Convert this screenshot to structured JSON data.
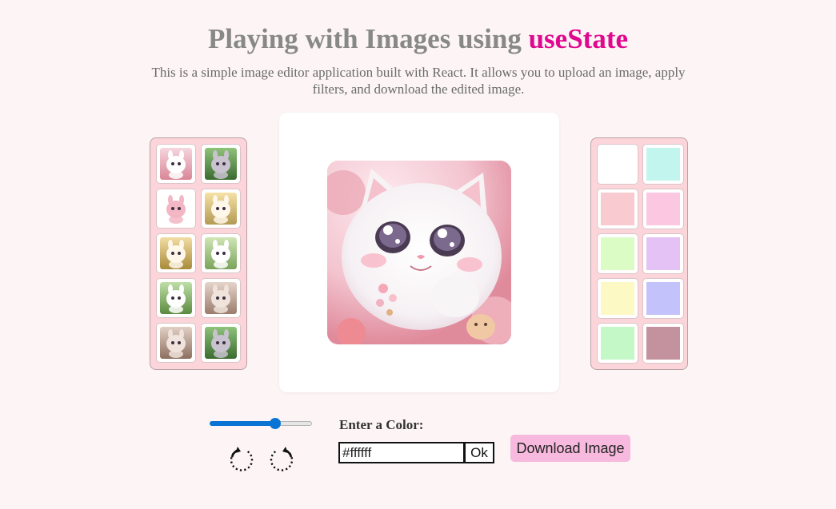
{
  "header": {
    "title_prefix": "Playing with Images using ",
    "title_accent": "useState",
    "subtitle": "This is a simple image editor application built with React. It allows you to upload an image, apply filters, and download the edited image."
  },
  "colors": {
    "accent": "#e0088e",
    "background": "#fdf5f5",
    "panel": "#fcd5da",
    "slider": "#0a74d4",
    "download": "#f7b9dd"
  },
  "thumbnails": [
    {
      "icon": "white-kitten-image",
      "bg": [
        "#f6d6df",
        "#d98697"
      ],
      "fg": "#ffffff"
    },
    {
      "icon": "forest-mouse-image",
      "bg": [
        "#8fc27a",
        "#3b6b2f"
      ],
      "fg": "#c9c3cf"
    },
    {
      "icon": "pink-sheep-image",
      "bg": [
        "#ffffff",
        "#ffffff"
      ],
      "fg": "#f2b6c4"
    },
    {
      "icon": "bunny-image",
      "bg": [
        "#f6e2a7",
        "#b39a52"
      ],
      "fg": "#fff7ea"
    },
    {
      "icon": "bunny-image",
      "bg": [
        "#f2dca3",
        "#a88b3a"
      ],
      "fg": "#fff7ea"
    },
    {
      "icon": "panda-image",
      "bg": [
        "#cfe6b4",
        "#7aa35c"
      ],
      "fg": "#ffffff"
    },
    {
      "icon": "panda-image",
      "bg": [
        "#bfe0a8",
        "#5b8a3f"
      ],
      "fg": "#ffffff"
    },
    {
      "icon": "brown-bunny-image",
      "bg": [
        "#e6d5cb",
        "#9b7c6c"
      ],
      "fg": "#efe3dc"
    },
    {
      "icon": "brown-bunny-image",
      "bg": [
        "#e2cfc4",
        "#8d6f60"
      ],
      "fg": "#efe3dc"
    },
    {
      "icon": "forest-mouse-image",
      "bg": [
        "#8fc27a",
        "#3b6b2f"
      ],
      "fg": "#c9c3cf"
    }
  ],
  "swatches": [
    "#ffffff",
    "#c2f5ed",
    "#f9cbd0",
    "#fcc7e0",
    "#dcfcc6",
    "#e4c2f5",
    "#fdf9c5",
    "#c3c2fb",
    "#c4f9c7",
    "#c4929e"
  ],
  "main_image": {
    "icon": "white-kitten-image"
  },
  "controls": {
    "slider_value": 0.64,
    "rotate_left_icon": "rotate-left-icon",
    "rotate_right_icon": "rotate-right-icon",
    "color_label": "Enter a Color:",
    "color_value": "#ffffff",
    "ok_label": "Ok",
    "download_label": "Download Image"
  }
}
